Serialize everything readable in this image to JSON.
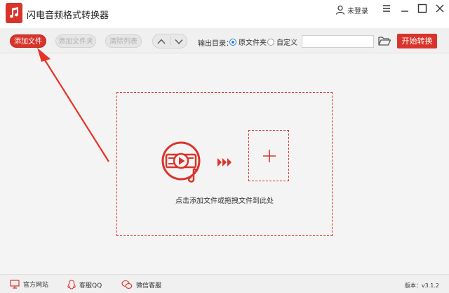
{
  "window": {
    "title": "闪电音频格式转换器",
    "user_label": "未登录"
  },
  "toolbar": {
    "add_file": "添加文件",
    "add_folder": "添加文件夹",
    "clear_list": "清除列表",
    "output_label": "输出目录：",
    "radio_original": "原文件夹",
    "radio_custom": "自定义",
    "selected_output": "原文件夹",
    "path_value": "",
    "start_button": "开始转换"
  },
  "main": {
    "drop_hint": "点击添加文件或拖拽文件到此处"
  },
  "status": {
    "website": "官方网站",
    "qq": "客服QQ",
    "wechat": "微信客服",
    "version": "版本：v3.1.2"
  },
  "colors": {
    "accent": "#d9342b",
    "background": "#f4f4f4",
    "radio_active": "#2f7cd6"
  },
  "icons": {
    "logo": "music-note-icon",
    "user": "user-icon",
    "minimize": "menu-icon",
    "maximize": "square-icon",
    "close": "close-icon",
    "up": "chevron-up-icon",
    "down": "chevron-down-icon",
    "folder": "folder-icon",
    "center": "audio-disc-icon",
    "forward": "triple-chevron-right-icon",
    "add": "plus-icon",
    "website": "monitor-icon",
    "qq": "penguin-icon",
    "wechat": "wechat-icon"
  }
}
